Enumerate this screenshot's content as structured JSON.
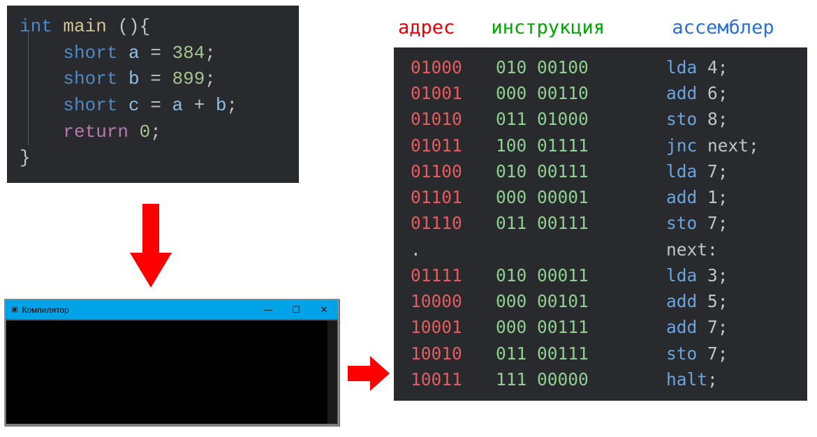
{
  "source": {
    "lines": [
      {
        "raw": "int main (){",
        "tokens": [
          [
            "kw",
            "int"
          ],
          [
            "pn",
            " "
          ],
          [
            "fn",
            "main"
          ],
          [
            "pn",
            " "
          ],
          [
            "pn",
            "()"
          ],
          [
            "pn",
            "{"
          ]
        ]
      },
      {
        "raw": "    short a = 384;",
        "tokens": [
          [
            "pn",
            "    "
          ],
          [
            "kw",
            "short"
          ],
          [
            "pn",
            " "
          ],
          [
            "var",
            "a"
          ],
          [
            "pn",
            " "
          ],
          [
            "op",
            "="
          ],
          [
            "pn",
            " "
          ],
          [
            "num",
            "384"
          ],
          [
            "pn",
            ";"
          ]
        ]
      },
      {
        "raw": "    short b = 899;",
        "tokens": [
          [
            "pn",
            "    "
          ],
          [
            "kw",
            "short"
          ],
          [
            "pn",
            " "
          ],
          [
            "var",
            "b"
          ],
          [
            "pn",
            " "
          ],
          [
            "op",
            "="
          ],
          [
            "pn",
            " "
          ],
          [
            "num",
            "899"
          ],
          [
            "pn",
            ";"
          ]
        ]
      },
      {
        "raw": "    short c = a + b;",
        "tokens": [
          [
            "pn",
            "    "
          ],
          [
            "kw",
            "short"
          ],
          [
            "pn",
            " "
          ],
          [
            "var",
            "c"
          ],
          [
            "pn",
            " "
          ],
          [
            "op",
            "="
          ],
          [
            "pn",
            " "
          ],
          [
            "var",
            "a"
          ],
          [
            "pn",
            " "
          ],
          [
            "op",
            "+"
          ],
          [
            "pn",
            " "
          ],
          [
            "var",
            "b"
          ],
          [
            "pn",
            ";"
          ]
        ]
      },
      {
        "raw": "    return 0;",
        "tokens": [
          [
            "pn",
            "    "
          ],
          [
            "ctl",
            "return"
          ],
          [
            "pn",
            " "
          ],
          [
            "num",
            "0"
          ],
          [
            "pn",
            ";"
          ]
        ]
      },
      {
        "raw": "}",
        "tokens": [
          [
            "pn",
            "}"
          ]
        ]
      }
    ]
  },
  "terminal": {
    "title": "Компилятор",
    "icon": "cmd-icon"
  },
  "asm_headers": {
    "address": "адрес",
    "instruction": "инструкция",
    "assembler": "ассемблер"
  },
  "asm": [
    {
      "addr": "01000",
      "instr": "010 00100",
      "op": "lda",
      "arg": "4",
      "semi": ";"
    },
    {
      "addr": "01001",
      "instr": "000 00110",
      "op": "add",
      "arg": "6",
      "semi": ";"
    },
    {
      "addr": "01010",
      "instr": "011 01000",
      "op": "sto",
      "arg": "8",
      "semi": ";"
    },
    {
      "addr": "01011",
      "instr": "100 01111",
      "op": "jnc",
      "arg": "next",
      "semi": ";"
    },
    {
      "addr": "01100",
      "instr": "010 00111",
      "op": "lda",
      "arg": "7",
      "semi": ";"
    },
    {
      "addr": "01101",
      "instr": "000 00001",
      "op": "add",
      "arg": "1",
      "semi": ";"
    },
    {
      "addr": "01110",
      "instr": "011 00111",
      "op": "sto",
      "arg": "7",
      "semi": ";"
    },
    {
      "addr": ".",
      "instr": "",
      "op": "",
      "arg": "",
      "label": "next:",
      "semi": ""
    },
    {
      "addr": "01111",
      "instr": "010 00011",
      "op": "lda",
      "arg": "3",
      "semi": ";"
    },
    {
      "addr": "10000",
      "instr": "000 00101",
      "op": "add",
      "arg": "5",
      "semi": ";"
    },
    {
      "addr": "10001",
      "instr": "000 00111",
      "op": "add",
      "arg": "7",
      "semi": ";"
    },
    {
      "addr": "10010",
      "instr": "011 00111",
      "op": "sto",
      "arg": "7",
      "semi": ";"
    },
    {
      "addr": "10011",
      "instr": "111 00000",
      "op": "halt",
      "arg": "",
      "semi": ";"
    }
  ],
  "colors": {
    "arrow": "#ff0000",
    "titlebar": "#00a2e8",
    "code_bg": "#282a2e"
  }
}
